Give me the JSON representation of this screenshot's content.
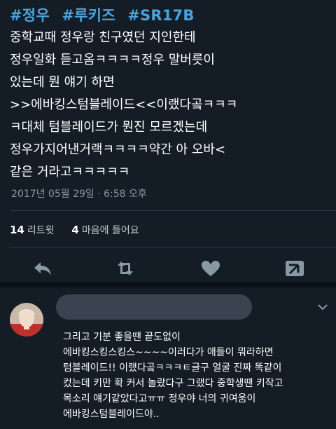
{
  "tweet": {
    "hashtags": [
      "#정우",
      "#루키즈",
      "#SR17B"
    ],
    "lines": [
      "중학교때 정우랑 친구였던 지인한테",
      "정우일화 듣고옴ㅋㅋㅋㅋ정우 말버릇이",
      "있는데 뭔 얘기 하면",
      ">>에바킹스텀블레이드<<이랬다곸ㅋㅋㅋ",
      "ㅋ대체 텀블레이드가 뭔진 모르겠는데",
      "정우가지어낸거랙ㅋㅋㅋㅋ약간 아 오바<",
      "같은 거라고ㅋㅋㅋㅋㅋ"
    ],
    "timestamp": "2017년 05월 29일 · 6:58 오후",
    "stats": {
      "retweets_count": "14",
      "retweets_label": "리트윗",
      "likes_count": "4",
      "likes_label": "마음에 들어요"
    },
    "actions": [
      "reply-icon",
      "retweet-icon",
      "heart-icon",
      "share-icon"
    ]
  },
  "reply": {
    "lines": [
      "그리고 기분 좋을땐 끝도없이",
      "에바킹스킹스킹스~~~~이러다가 애들이 뭐라하면",
      "텀블레이드!! 이랬다곸ㅋㅋㅋㅌ글구 얼굴 진짜 똑같이",
      "컸는데 키만 확 커서 놀랐다구 그랬다 중학생땐 키작고",
      "목소리 얘기같았다고ㅠㅠ 정우야 너의 귀여움이",
      "에바킹스텀블레이드야.."
    ]
  },
  "colors": {
    "background": "#141d26",
    "hashtag": "#4aa3df",
    "muted": "#8899a6"
  }
}
